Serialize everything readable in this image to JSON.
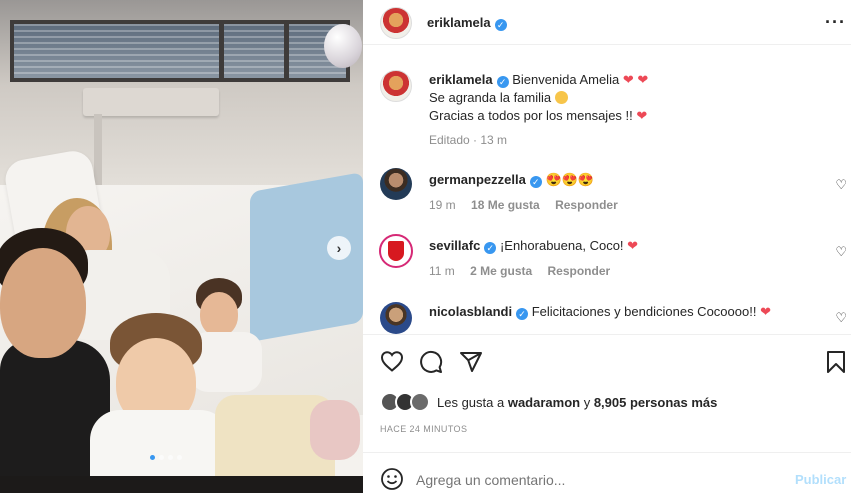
{
  "post": {
    "image_alt": "Family photo in hospital room",
    "carousel_next": "›"
  },
  "header": {
    "username": "eriklamela",
    "more_icon": "more-horizontal-icon"
  },
  "caption": {
    "username": "eriklamela",
    "line1": "Bienvenida Amelia",
    "line2": "Se agranda la familia",
    "line3": "Gracias a todos por los mensajes !!",
    "meta": "Editado · 13 m"
  },
  "comments": [
    {
      "username": "germanpezzella",
      "text": "😍😍😍",
      "time": "19 m",
      "likes": "18 Me gusta",
      "reply": "Responder"
    },
    {
      "username": "sevillafc",
      "text": "¡Enhorabuena, Coco!",
      "time": "11 m",
      "likes": "2 Me gusta",
      "reply": "Responder"
    },
    {
      "username": "nicolasblandi",
      "text": "Felicitaciones y bendiciones Cocoooo!!",
      "time": "",
      "likes": "",
      "reply": ""
    }
  ],
  "likes": {
    "prefix": "Les gusta a ",
    "user": "wadaramon",
    "middle": " y ",
    "count": "8,905 personas más"
  },
  "timestamp": "HACE 24 MINUTOS",
  "comment_box": {
    "placeholder": "Agrega un comentario...",
    "publish": "Publicar"
  },
  "colors": {
    "verified": "#3897f0",
    "heart": "#ed4956",
    "publish": "#b2dffc"
  }
}
